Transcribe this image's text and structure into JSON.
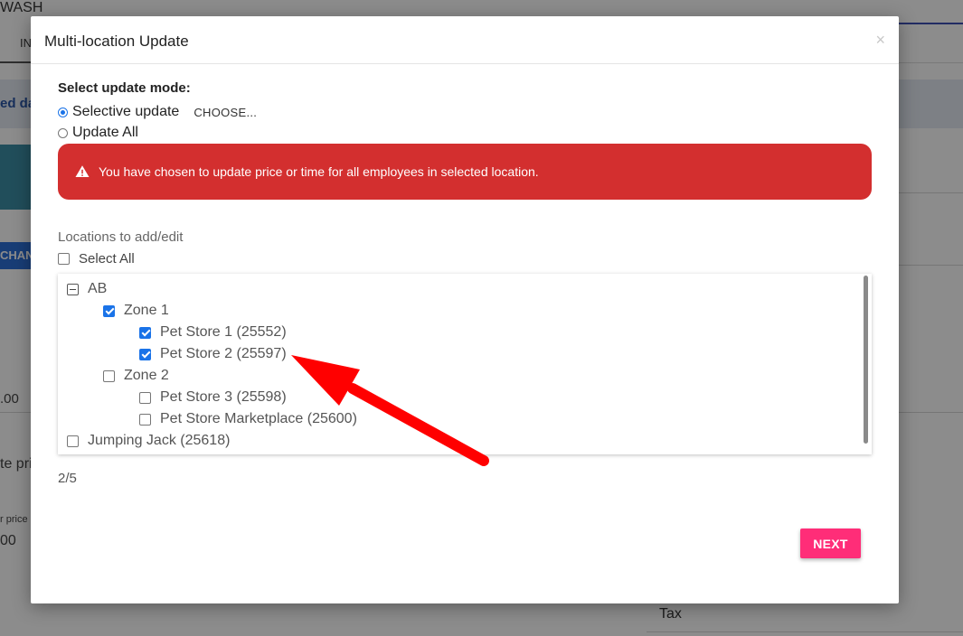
{
  "background": {
    "title": "WASH",
    "tab": "IN",
    "banner_text": "ed da",
    "change_button": "CHAN",
    "value1": ".00",
    "label1": "te pri",
    "label2": "r price",
    "value2": "00",
    "tax_label": "Tax"
  },
  "modal": {
    "title": "Multi-location Update",
    "close": "×",
    "mode_label": "Select update mode:",
    "modes": [
      {
        "label": "Selective update",
        "checked": true
      },
      {
        "label": "Update All",
        "checked": false
      }
    ],
    "choose_label": "CHOOSE...",
    "alert_text": "You have chosen to update price or time for all employees in selected location.",
    "locations_label": "Locations to add/edit",
    "select_all_label": "Select All",
    "tree": [
      {
        "label": "AB",
        "state": "collapse"
      },
      {
        "label": "Zone 1",
        "state": "checked"
      },
      {
        "label": "Pet Store 1 (25552)",
        "state": "checked"
      },
      {
        "label": "Pet Store 2 (25597)",
        "state": "checked"
      },
      {
        "label": "Zone 2",
        "state": "unchecked"
      },
      {
        "label": "Pet Store 3 (25598)",
        "state": "unchecked"
      },
      {
        "label": "Pet Store Marketplace (25600)",
        "state": "unchecked"
      },
      {
        "label": "Jumping Jack (25618)",
        "state": "unchecked"
      }
    ],
    "counter": "2/5",
    "next_label": "NEXT"
  },
  "colors": {
    "alert": "#d32f2f",
    "accent": "#1a73e8",
    "next_button": "#ff2d78",
    "arrow": "#ff0000"
  }
}
